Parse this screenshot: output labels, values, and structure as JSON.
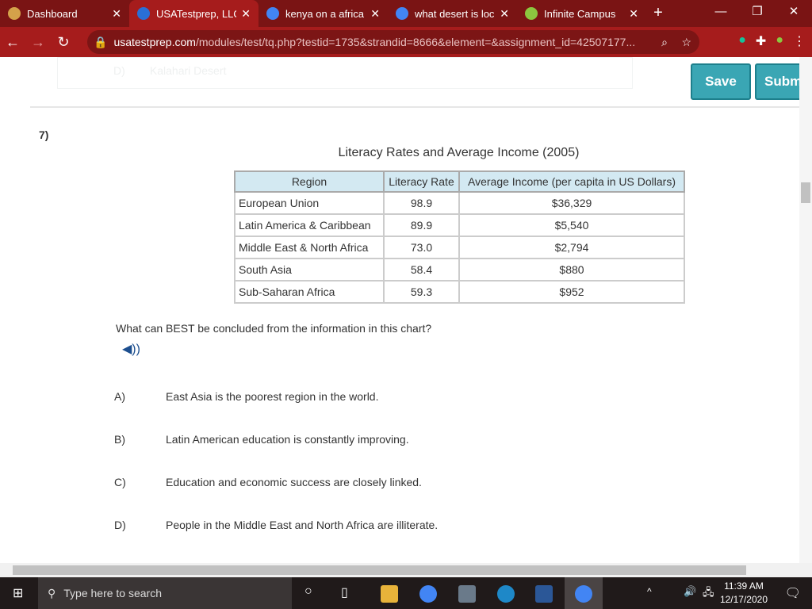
{
  "browser": {
    "tabs": [
      {
        "title": "Dashboard",
        "color": "#d4a24a"
      },
      {
        "title": "USATestprep, LLC",
        "color": "#2a6fd6"
      },
      {
        "title": "kenya on a africa",
        "color": "#4285f4"
      },
      {
        "title": "what desert is loc",
        "color": "#4285f4"
      },
      {
        "title": "Infinite Campus",
        "color": "#8cc63f"
      }
    ],
    "url_host": "usatestprep.com",
    "url_path": "/modules/test/tq.php?testid=1735&strandid=8666&element=&assignment_id=42507177..."
  },
  "page": {
    "prev_option_letter": "D)",
    "prev_option_text": "Kalahari Desert",
    "save_label": "Save",
    "submit_label": "Subm",
    "question_number": "7)",
    "question": "What can BEST be concluded from the information in this chart?",
    "options": [
      {
        "letter": "A)",
        "text": "East Asia is the poorest region in the world."
      },
      {
        "letter": "B)",
        "text": "Latin American education is constantly improving."
      },
      {
        "letter": "C)",
        "text": "Education and economic success are closely linked."
      },
      {
        "letter": "D)",
        "text": "People in the Middle East and North Africa are illiterate."
      }
    ]
  },
  "chart_data": {
    "type": "table",
    "title": "Literacy Rates and Average Income (2005)",
    "columns": [
      "Region",
      "Literacy Rate",
      "Average Income (per capita in US Dollars)"
    ],
    "rows": [
      [
        "European Union",
        "98.9",
        "$36,329"
      ],
      [
        "Latin America & Caribbean",
        "89.9",
        "$5,540"
      ],
      [
        "Middle East & North Africa",
        "73.0",
        "$2,794"
      ],
      [
        "South Asia",
        "58.4",
        "$880"
      ],
      [
        "Sub-Saharan Africa",
        "59.3",
        "$952"
      ]
    ]
  },
  "taskbar": {
    "search_placeholder": "Type here to search",
    "time": "11:39 AM",
    "date": "12/17/2020"
  }
}
